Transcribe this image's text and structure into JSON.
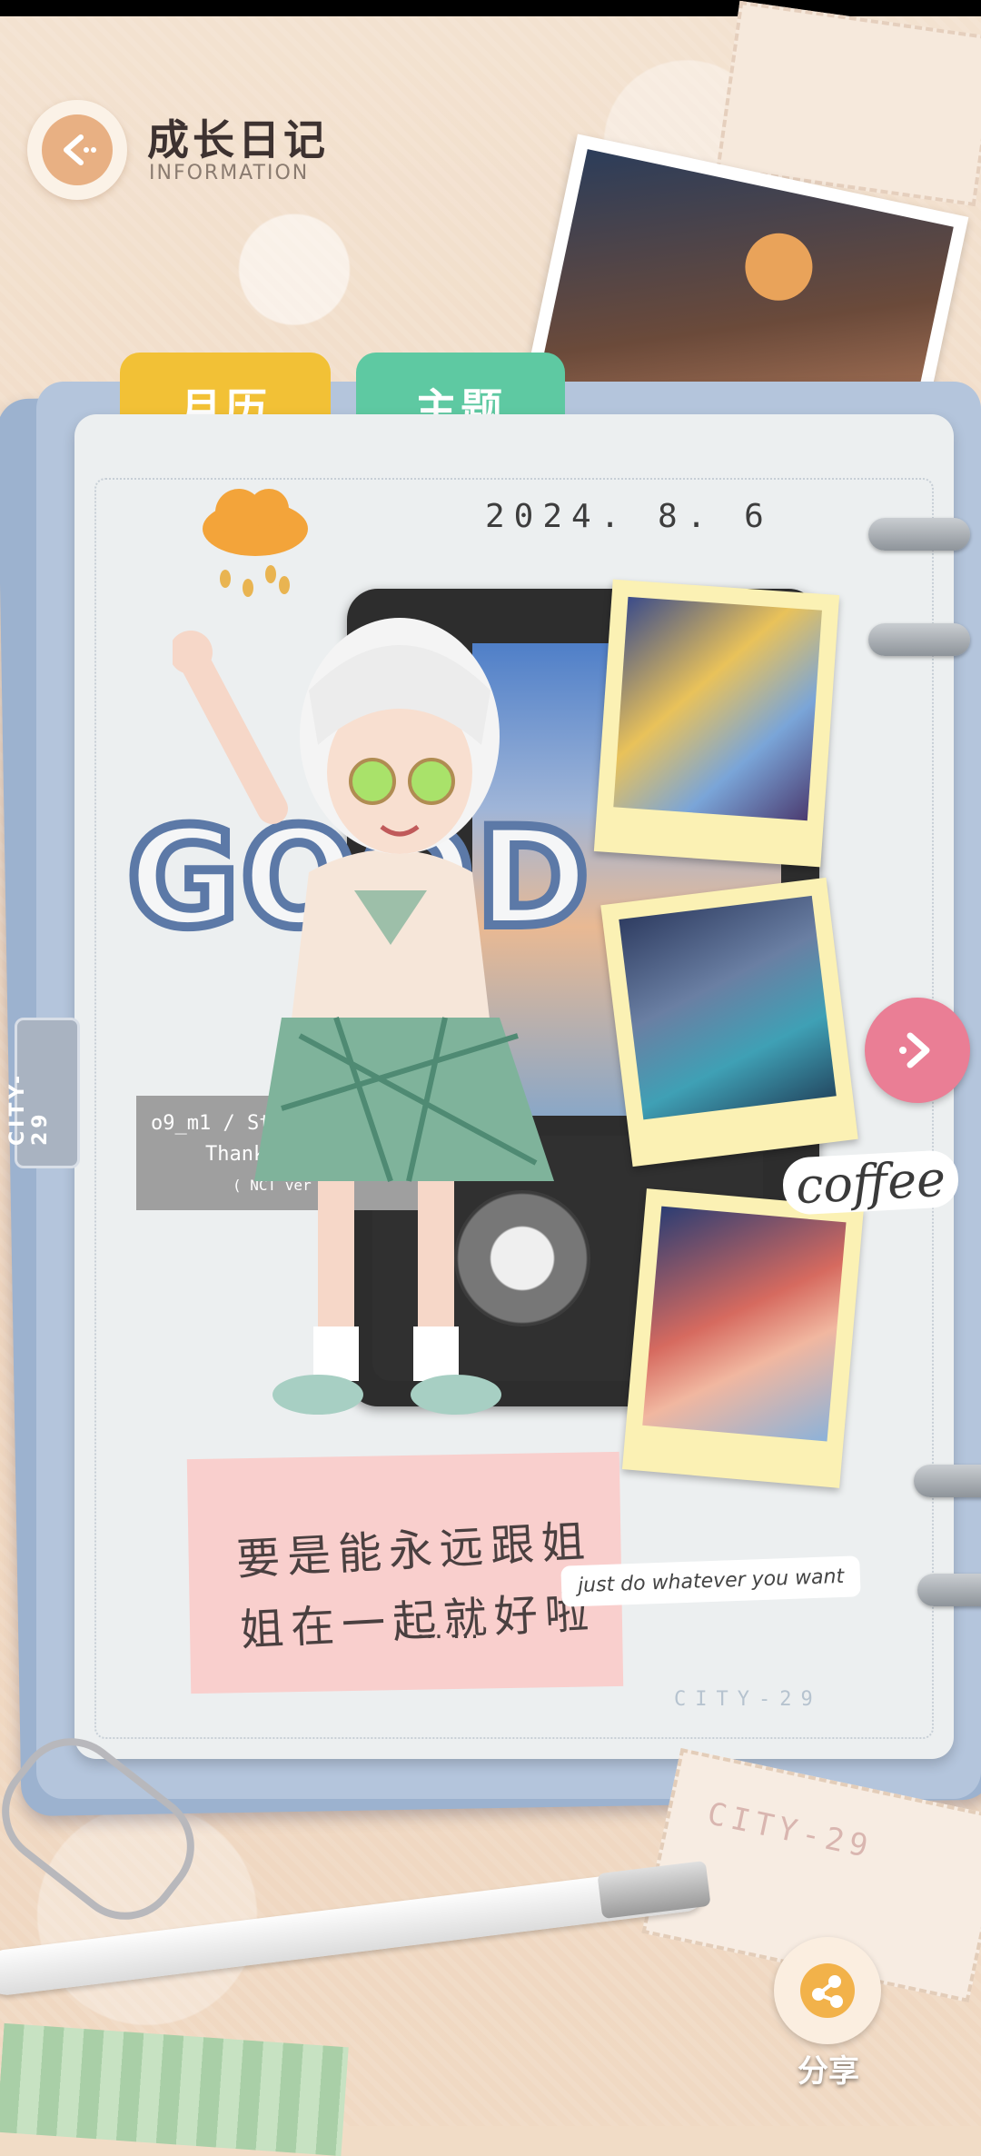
{
  "header": {
    "title": "成长日记",
    "subtitle": "INFORMATION"
  },
  "tabs": [
    {
      "label": "月历",
      "color": "#f2c136"
    },
    {
      "label": "主题",
      "color": "#5ec9a2"
    }
  ],
  "diary": {
    "date": "2024. 8. 6",
    "weather_icon": "cloud-rain-icon",
    "sticker_good": "GOOD",
    "song_tag": {
      "line1": "o9_m1 / Stick",
      "line2": "Thank you",
      "line3": "( NCT ver )"
    },
    "coffee_sticker": "coffee",
    "note": {
      "line1": "要是能永远跟姐",
      "line2": "姐在一起就好啦",
      "ellipsis": "… …"
    },
    "motto_tag": "just do whatever you want",
    "footer_brand": "CITY-29"
  },
  "side_tag": "CITY-29",
  "bottom_stamp": "CITY-29",
  "share": {
    "label": "分享"
  },
  "colors": {
    "accent_pink": "#ea7e95",
    "tab_yellow": "#f2c136",
    "tab_green": "#5ec9a2",
    "binder_blue": "#9cb2cf"
  }
}
